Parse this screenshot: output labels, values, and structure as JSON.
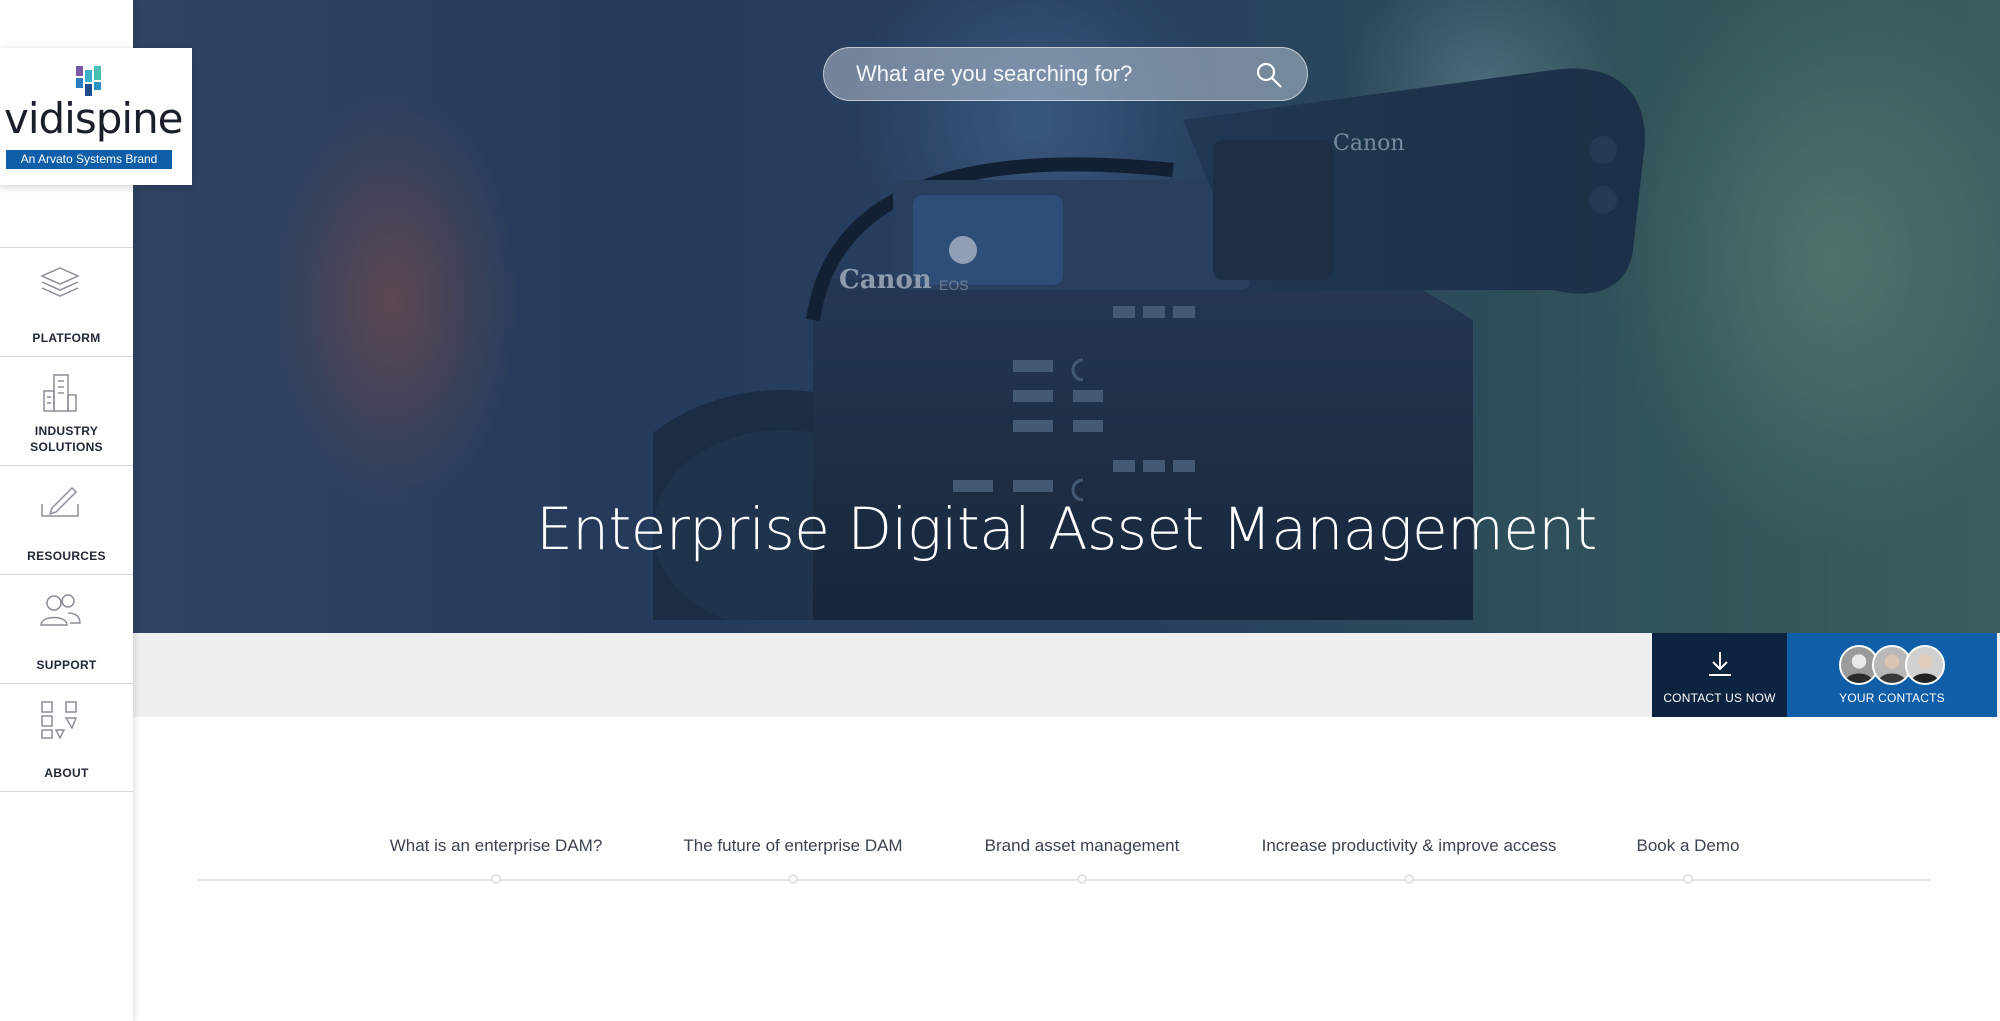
{
  "brand": {
    "name": "vidispine",
    "tagline": "An Arvato Systems Brand",
    "colors": {
      "primary": "#0f5ea7",
      "dark": "#0d2440"
    }
  },
  "sidebar": {
    "items": [
      {
        "label": "PLATFORM",
        "icon": "stack-layers-icon"
      },
      {
        "label": "INDUSTRY SOLUTIONS",
        "icon": "buildings-icon"
      },
      {
        "label": "RESOURCES",
        "icon": "pen-icon"
      },
      {
        "label": "SUPPORT",
        "icon": "people-icon"
      },
      {
        "label": "ABOUT",
        "icon": "blocks-icon"
      }
    ]
  },
  "search": {
    "placeholder": "What are you searching for?",
    "icon": "search-icon"
  },
  "hero": {
    "title": "Enterprise Digital Asset Management"
  },
  "camera": {
    "brand_top": "Canon",
    "brand_side": "Canon",
    "model": "EOS"
  },
  "actions": {
    "contact_now": "CONTACT US NOW",
    "your_contacts": "YOUR CONTACTS"
  },
  "anchors": [
    "What is an enterprise DAM?",
    "The future of enterprise DAM",
    "Brand asset management",
    "Increase productivity & improve access",
    "Book a Demo"
  ]
}
